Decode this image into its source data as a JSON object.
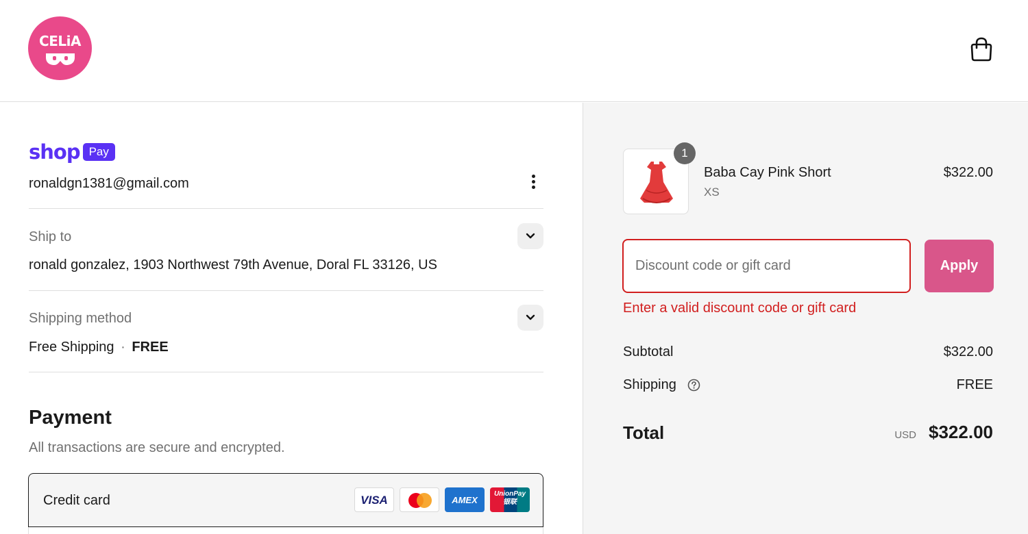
{
  "brand": {
    "logo_text": "CELiA"
  },
  "header": {
    "cart_icon": "shopping-bag-icon"
  },
  "contact": {
    "shop_pay_word": "shop",
    "shop_pay_badge": "Pay",
    "email": "ronaldgn1381@gmail.com",
    "menu_icon": "vertical-dots-icon"
  },
  "ship_to": {
    "label": "Ship to",
    "value": "ronald gonzalez, 1903 Northwest 79th Avenue, Doral FL 33126, US"
  },
  "shipping_method": {
    "label": "Shipping method",
    "value": "Free Shipping",
    "separator": "·",
    "price": "FREE"
  },
  "payment": {
    "title": "Payment",
    "subtitle": "All transactions are secure and encrypted.",
    "method_label": "Credit card",
    "cards": [
      "VISA",
      "mastercard",
      "AMEX",
      "UnionPay"
    ],
    "unionpay_cn": "银联"
  },
  "order": {
    "item": {
      "quantity": "1",
      "name": "Baba Cay Pink Short",
      "variant": "XS",
      "price": "$322.00"
    },
    "discount": {
      "placeholder": "Discount code or gift card",
      "value": "",
      "apply_label": "Apply",
      "error": "Enter a valid discount code or gift card"
    },
    "subtotal_label": "Subtotal",
    "subtotal_value": "$322.00",
    "shipping_label": "Shipping",
    "shipping_value": "FREE",
    "total_label": "Total",
    "total_currency": "USD",
    "total_value": "$322.00"
  },
  "colors": {
    "brand_pink": "#e9498a",
    "apply_button": "#d9568a",
    "error_red": "#d11e1e",
    "shop_pay_purple": "#5a31f4"
  }
}
